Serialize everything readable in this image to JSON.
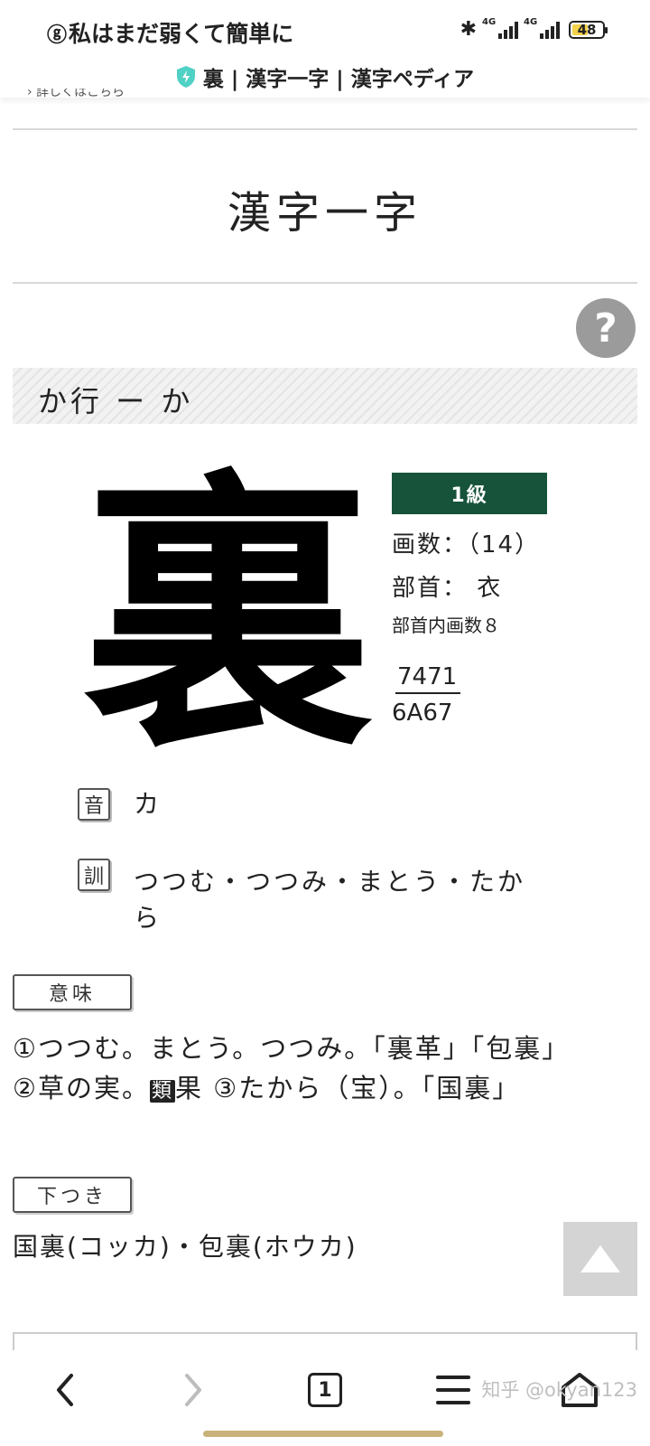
{
  "status_bar": {
    "notification_text": "私はまだ弱くて簡単に",
    "network_1": "4G",
    "network_2": "4G",
    "battery_level": "48"
  },
  "browser": {
    "page_title": "裏 | 漢字一字 | 漢字ペディア",
    "clipped_link": "詳しくはこちら"
  },
  "content": {
    "heading": "漢字一字",
    "help_label": "?",
    "row_label": "か行 ー か",
    "kanji": "裏",
    "grade": "1級",
    "stroke_count": "画数：（14）",
    "radical": "部首：  衣",
    "radical_strokes": "部首内画数８",
    "code_top": "7471",
    "code_bottom": "6A67",
    "on_label": "音",
    "on_reading": "カ",
    "kun_label": "訓",
    "kun_reading_line1": "つつむ・つつみ・まとう・たか",
    "kun_reading_line2": "ら",
    "meaning_label": "意味",
    "meaning_part1": "①つつむ。まとう。つつみ。「裏革」「包裏」 ②草の実。",
    "meaning_rui": "類",
    "meaning_part2": "果 ③たから（宝）。「国裏」",
    "shitatsuki_label": "下つき",
    "compounds": "国裏(コッカ)・包裏(ホウカ)"
  },
  "bottom_nav": {
    "back_icon": "chevron-left-icon",
    "forward_icon": "chevron-right-icon",
    "tab_count": "1",
    "menu_icon": "hamburger-icon",
    "home_icon": "home-icon",
    "watermark": "知乎 @okyan123"
  },
  "colors": {
    "grade_bg": "#17533a",
    "help_bg": "#9b9b9b",
    "shield": "#4fd1c5"
  }
}
